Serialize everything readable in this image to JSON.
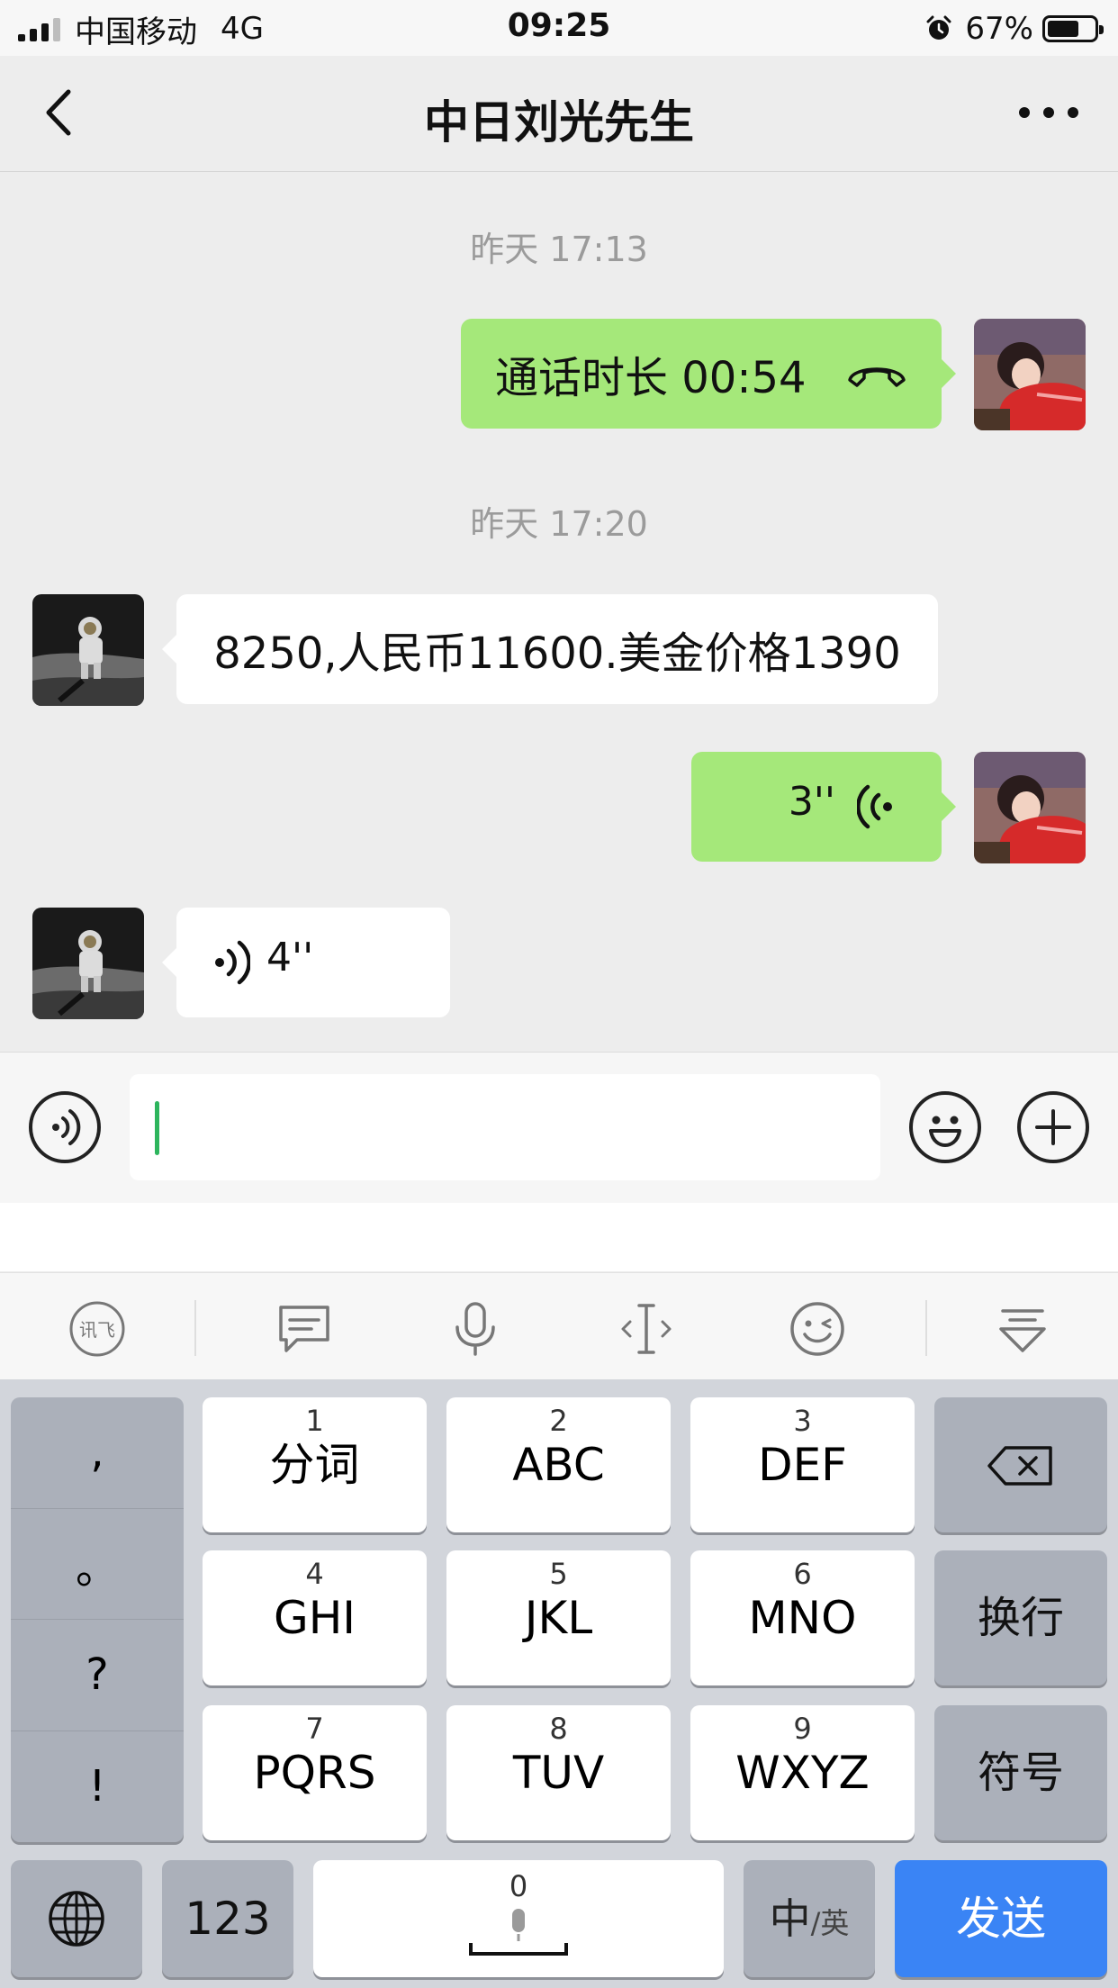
{
  "status_bar": {
    "carrier": "中国移动",
    "network": "4G",
    "time": "09:25",
    "battery": "67%",
    "battery_level": 0.67
  },
  "nav": {
    "title": "中日刘光先生"
  },
  "messages": [
    {
      "type": "time",
      "text": "昨天 17:13"
    },
    {
      "type": "call",
      "sender": "me",
      "text": "通话时长 00:54"
    },
    {
      "type": "time",
      "text": "昨天 17:20"
    },
    {
      "type": "text",
      "sender": "other",
      "text": "8250,人民币11600.美金价格1390"
    },
    {
      "type": "voice",
      "sender": "me",
      "duration": "3''"
    },
    {
      "type": "voice",
      "sender": "other",
      "duration": "4''"
    }
  ],
  "input": {
    "value": ""
  },
  "keyboard": {
    "punctuation": [
      ",",
      "。",
      "?",
      "!"
    ],
    "keys": [
      {
        "num": "1",
        "label": "分词"
      },
      {
        "num": "2",
        "label": "ABC"
      },
      {
        "num": "3",
        "label": "DEF"
      },
      {
        "num": "4",
        "label": "GHI"
      },
      {
        "num": "5",
        "label": "JKL"
      },
      {
        "num": "6",
        "label": "MNO"
      },
      {
        "num": "7",
        "label": "PQRS"
      },
      {
        "num": "8",
        "label": "TUV"
      },
      {
        "num": "9",
        "label": "WXYZ"
      }
    ],
    "newline": "换行",
    "symbols": "符号",
    "numbers": "123",
    "space_num": "0",
    "lang_main": "中",
    "lang_alt": "/英",
    "send": "发送"
  },
  "colors": {
    "my_bubble": "#a5e87a",
    "send_key": "#3a84f5",
    "cursor": "#2db55d"
  }
}
